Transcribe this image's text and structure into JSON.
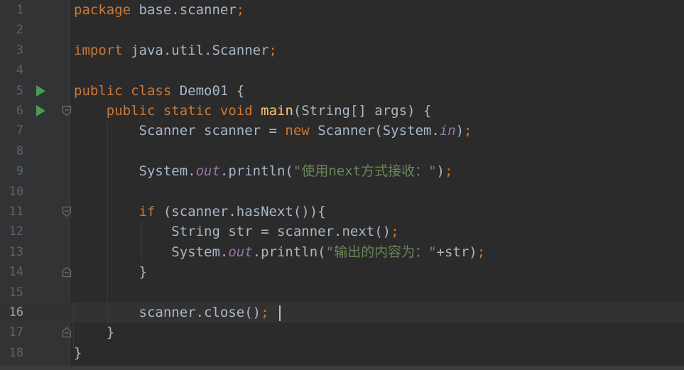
{
  "editor": {
    "current_line": 16,
    "lines": [
      {
        "num": "1",
        "tokens": [
          {
            "t": "package",
            "c": "kw"
          },
          {
            "t": " base.scanner"
          },
          {
            "t": ";",
            "c": "kw"
          }
        ]
      },
      {
        "num": "2",
        "tokens": []
      },
      {
        "num": "3",
        "tokens": [
          {
            "t": "import",
            "c": "kw"
          },
          {
            "t": " java.util.Scanner"
          },
          {
            "t": ";",
            "c": "kw"
          }
        ]
      },
      {
        "num": "4",
        "tokens": []
      },
      {
        "num": "5",
        "run": true,
        "tokens": [
          {
            "t": "public class",
            "c": "kw"
          },
          {
            "t": " Demo01 {"
          }
        ]
      },
      {
        "num": "6",
        "run": true,
        "fold": "open",
        "tokens": [
          {
            "t": "    "
          },
          {
            "t": "public static void",
            "c": "kw"
          },
          {
            "t": " "
          },
          {
            "t": "main",
            "c": "fn"
          },
          {
            "t": "(String[] args) {"
          }
        ]
      },
      {
        "num": "7",
        "tokens": [
          {
            "t": "        Scanner scanner = "
          },
          {
            "t": "new",
            "c": "kw"
          },
          {
            "t": " Scanner(System."
          },
          {
            "t": "in",
            "c": "fld"
          },
          {
            "t": ")"
          },
          {
            "t": ";",
            "c": "kw"
          }
        ]
      },
      {
        "num": "8",
        "tokens": []
      },
      {
        "num": "9",
        "tokens": [
          {
            "t": "        System."
          },
          {
            "t": "out",
            "c": "fld"
          },
          {
            "t": ".println("
          },
          {
            "t": "\"使用next方式接收：\"",
            "c": "str"
          },
          {
            "t": ")"
          },
          {
            "t": ";",
            "c": "kw"
          }
        ]
      },
      {
        "num": "10",
        "tokens": []
      },
      {
        "num": "11",
        "fold": "open",
        "tokens": [
          {
            "t": "        "
          },
          {
            "t": "if",
            "c": "kw"
          },
          {
            "t": " (scanner.hasNext()){"
          }
        ]
      },
      {
        "num": "12",
        "tokens": [
          {
            "t": "            String str = scanner.next()"
          },
          {
            "t": ";",
            "c": "kw"
          }
        ]
      },
      {
        "num": "13",
        "tokens": [
          {
            "t": "            System."
          },
          {
            "t": "out",
            "c": "fld"
          },
          {
            "t": ".println("
          },
          {
            "t": "\"输出的内容为：\"",
            "c": "str"
          },
          {
            "t": "+str)"
          },
          {
            "t": ";",
            "c": "kw"
          }
        ]
      },
      {
        "num": "14",
        "fold": "close",
        "tokens": [
          {
            "t": "        }"
          }
        ]
      },
      {
        "num": "15",
        "tokens": []
      },
      {
        "num": "16",
        "tokens": [
          {
            "t": "        scanner.close()"
          },
          {
            "t": ";",
            "c": "kw"
          }
        ]
      },
      {
        "num": "17",
        "fold": "close",
        "tokens": [
          {
            "t": "    }"
          }
        ]
      },
      {
        "num": "18",
        "tokens": [
          {
            "t": "}"
          }
        ]
      }
    ]
  },
  "icons": {
    "run": "run-gutter-icon",
    "fold_open": "fold-expand-icon",
    "fold_close": "fold-end-icon"
  },
  "colors": {
    "background": "#2b2b2b",
    "gutter": "#313335",
    "keyword": "#cc7832",
    "method": "#ffc66d",
    "string": "#6a8759",
    "field": "#9876aa",
    "text": "#a9b7c6",
    "run": "#499c54"
  }
}
